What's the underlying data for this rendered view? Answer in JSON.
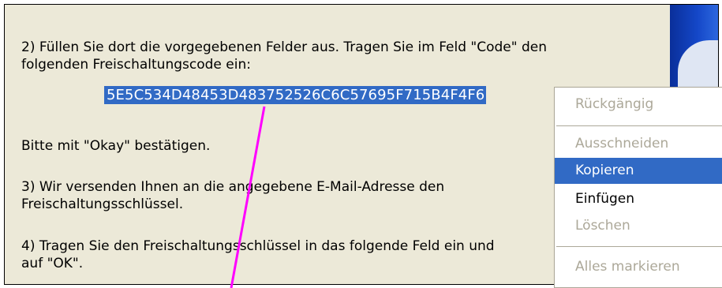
{
  "instructions": {
    "step2_line1": "2) Füllen Sie dort die vorgegebenen Felder aus. Tragen Sie im Feld \"Code\" den",
    "step2_line2": "folgenden Freischaltungscode ein:",
    "activation_code": "5E5C534D48453D483752526C6C57695F715B4F4F6",
    "confirm": "Bitte mit \"Okay\" bestätigen.",
    "step3_line1": "3) Wir versenden Ihnen an die angegebene E-Mail-Adresse den",
    "step3_line2": "Freischaltungsschlüssel.",
    "step4_line1": "4) Tragen Sie den Freischaltungsschlüssel in das folgende Feld ein und",
    "step4_line2": "auf \"OK\"."
  },
  "context_menu": {
    "items": [
      {
        "label": "Rückgängig",
        "enabled": false
      },
      {
        "label": "Ausschneiden",
        "enabled": false
      },
      {
        "label": "Kopieren",
        "enabled": true,
        "highlighted": true
      },
      {
        "label": "Einfügen",
        "enabled": true
      },
      {
        "label": "Löschen",
        "enabled": false
      },
      {
        "label": "Alles markieren",
        "enabled": false
      }
    ]
  },
  "colors": {
    "panel_bg": "#ECE9D8",
    "selection": "#316AC5",
    "annotation_arrow": "#FF00FF",
    "disabled_text": "#ACA899"
  }
}
